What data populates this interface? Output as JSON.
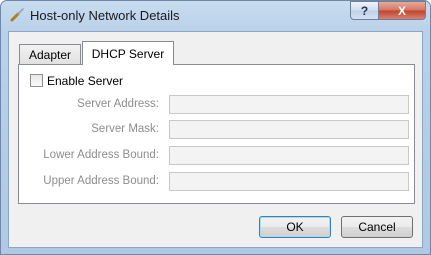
{
  "window": {
    "title": "Host-only Network Details",
    "help_symbol": "?",
    "close_symbol": "X"
  },
  "tabs": [
    {
      "label": "Adapter",
      "active": false
    },
    {
      "label": "DHCP Server",
      "active": true
    }
  ],
  "dhcp": {
    "enable_label": "Enable Server",
    "enabled": false,
    "fields": [
      {
        "label": "Server Address:",
        "value": ""
      },
      {
        "label": "Server Mask:",
        "value": ""
      },
      {
        "label": "Lower Address Bound:",
        "value": ""
      },
      {
        "label": "Upper Address Bound:",
        "value": ""
      }
    ]
  },
  "buttons": {
    "ok_label": "OK",
    "cancel_label": "Cancel"
  },
  "colors": {
    "accent": "#3c7fb1",
    "disabled_text": "#8d8d8d"
  }
}
